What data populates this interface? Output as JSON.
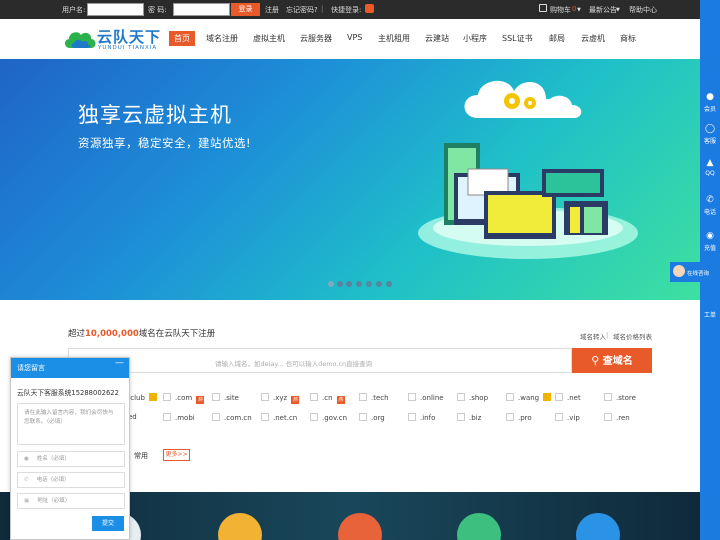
{
  "topbar": {
    "username_label": "用户名:",
    "password_label": "密  码:",
    "login_button": "登录",
    "register_link": "注册",
    "forgot_link": "忘记密码?",
    "quick_login_label": "快捷登录:",
    "cart_label": "购物车",
    "cart_count": "0",
    "notice_label": "最新公告",
    "help_label": "帮助中心"
  },
  "header": {
    "logo_cn": "云队天下",
    "logo_en": "YUNDUI TIANXIA",
    "nav": [
      "首页",
      "域名注册",
      "虚拟主机",
      "云服务器",
      "VPS",
      "主机租用",
      "云建站",
      "小程序",
      "SSL证书",
      "邮局",
      "云虚机",
      "商标"
    ]
  },
  "banner": {
    "title": "独享云虚拟主机",
    "subtitle": "资源独享，稳定安全，建站优选!",
    "slide_count": 7
  },
  "domain": {
    "heading_prefix": "超过",
    "heading_number": "10,000,000",
    "heading_suffix": "域名在云队天下注册",
    "transfer_link": "域名转入",
    "price_link": "域名价格列表",
    "search_placeholder": "请输入域名，如deiay... 也可以输入demo.cn直接查询",
    "search_button": "查域名",
    "tlds_row1": [
      ".club",
      ".com",
      ".site",
      ".xyz",
      ".cn",
      ".tech",
      ".online",
      ".shop",
      ".wang",
      ".net",
      ".store"
    ],
    "tlds_row2": [
      "ed",
      ".mobi",
      ".com.cn",
      ".net.cn",
      ".gov.cn",
      ".org",
      ".info",
      ".biz",
      ".pro",
      ".vip",
      ".ren"
    ],
    "common_label": "常用",
    "more_button": "更多>>"
  },
  "rightbar": {
    "items": [
      "会员",
      "客服",
      "QQ",
      "电话",
      "充值"
    ],
    "online_chat": "在线咨询",
    "ticket": "工单"
  },
  "chat": {
    "title": "请您留言",
    "minimize": "—",
    "service_line": "云队天下客服系统15288002622",
    "message_placeholder": "请在此输入留言内容，我们会尽快与您联系。（必填）",
    "name_placeholder": "姓名（必填）",
    "phone_placeholder": "电话（必填）",
    "address_placeholder": "地址（必填）",
    "submit": "提交"
  },
  "colors": {
    "accent": "#e85a2a",
    "brand_blue": "#1b7be0",
    "topbar": "#2b2b2b"
  }
}
